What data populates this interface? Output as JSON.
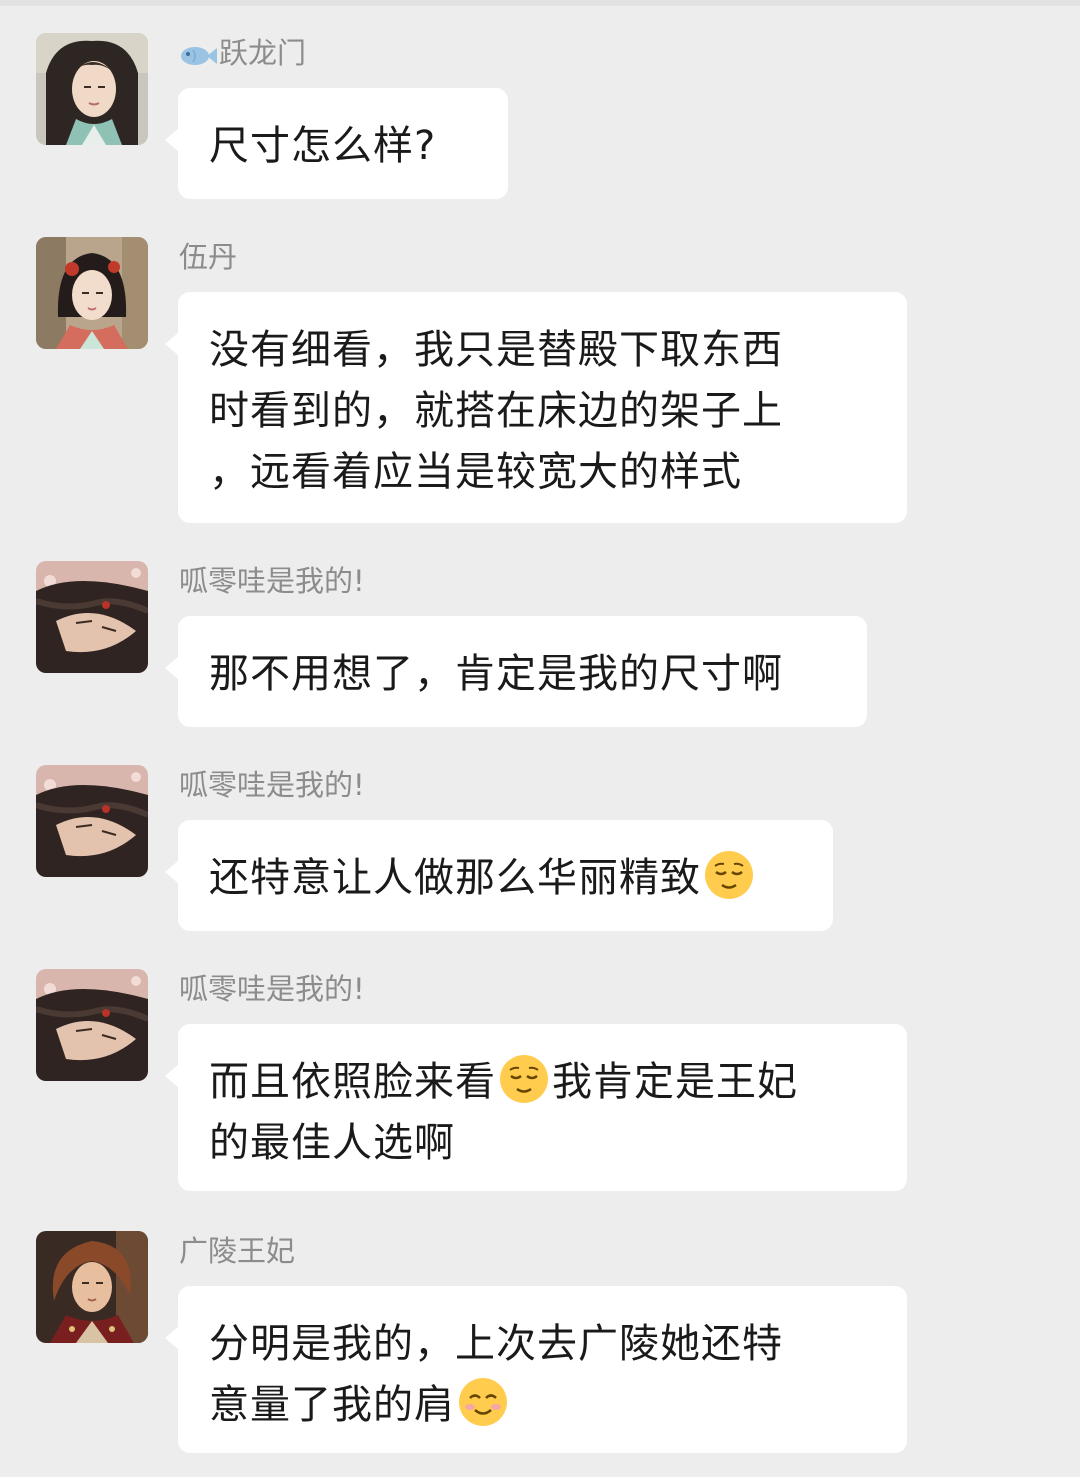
{
  "messages": [
    {
      "sender": "跃龙门",
      "sender_icon": "fish-icon",
      "avatar": "avatar-green-robed-man",
      "lines": [
        [
          "尺寸怎么样?"
        ]
      ]
    },
    {
      "sender": "伍丹",
      "avatar": "avatar-lady-red-hairpin",
      "lines": [
        [
          "没有细看，我只是替殿下取东西"
        ],
        [
          "时看到的，就搭在床边的架子上"
        ],
        [
          "，远看着应当是较宽大的样式"
        ]
      ]
    },
    {
      "sender": "呱零哇是我的!",
      "avatar": "avatar-dark-haired-man",
      "lines": [
        [
          "那不用想了，肯定是我的尺寸啊"
        ]
      ]
    },
    {
      "sender": "呱零哇是我的!",
      "avatar": "avatar-dark-haired-man",
      "lines": [
        [
          "还特意让人做那么华丽精致",
          "relieved-face-emoji"
        ]
      ]
    },
    {
      "sender": "呱零哇是我的!",
      "avatar": "avatar-dark-haired-man",
      "lines": [
        [
          "而且依照脸来看",
          "relieved-face-emoji",
          "我肯定是王妃"
        ],
        [
          "的最佳人选啊"
        ]
      ]
    },
    {
      "sender": "广陵王妃",
      "avatar": "avatar-auburn-haired-man",
      "lines": [
        [
          "分明是我的，上次去广陵她还特"
        ],
        [
          "意量了我的肩",
          "smiling-face-emoji"
        ]
      ]
    }
  ]
}
